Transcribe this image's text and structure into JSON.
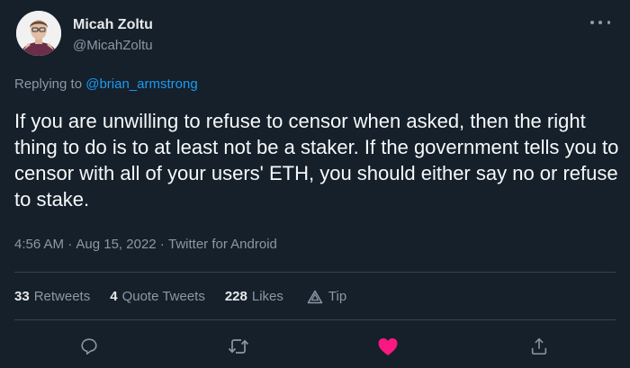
{
  "author": {
    "name": "Micah Zoltu",
    "handle": "@MicahZoltu"
  },
  "reply": {
    "prefix": "Replying to ",
    "to": "@brian_armstrong"
  },
  "tweet": {
    "text": "If you are unwilling to refuse to censor when asked, then the right thing to do is to at least not be a staker.  If the government tells you to censor with all of your users' ETH, you should either say no or refuse to stake."
  },
  "meta": {
    "time": "4:56 AM",
    "sep1": " · ",
    "date": "Aug 15, 2022",
    "sep2": " · ",
    "source": "Twitter for Android"
  },
  "stats": {
    "retweets_count": "33",
    "retweets_label": "Retweets",
    "quotes_count": "4",
    "quotes_label": "Quote Tweets",
    "likes_count": "228",
    "likes_label": "Likes",
    "tip_label": "Tip"
  },
  "colors": {
    "background": "#15202b",
    "text": "#e7e9ea",
    "secondary": "#8b98a5",
    "link": "#1d9bf0",
    "like": "#f91880",
    "divider": "#38444d"
  },
  "icons": {
    "more": "more-dots-icon",
    "reply": "reply-icon",
    "retweet": "retweet-icon",
    "like": "heart-filled-icon",
    "share": "share-icon",
    "tip": "tip-icon"
  }
}
